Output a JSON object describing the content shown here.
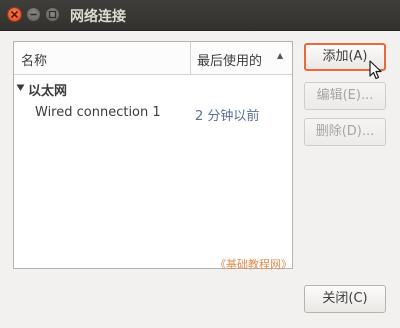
{
  "window": {
    "title": "网络连接"
  },
  "list": {
    "columns": {
      "name": "名称",
      "last_used": "最后使用的"
    },
    "sort_indicator": "▲",
    "group": {
      "label": "以太网"
    },
    "connections": [
      {
        "name": "Wired connection 1",
        "last_used": "2 分钟以前"
      }
    ],
    "watermark": "《基础教程网》"
  },
  "buttons": {
    "add": "添加(A)",
    "edit": "编辑(E)...",
    "delete": "删除(D)...",
    "close": "关闭(C)"
  },
  "colors": {
    "accent": "#e9683c",
    "titlebar": "#3a3936",
    "time_text": "#5a6f9a"
  }
}
